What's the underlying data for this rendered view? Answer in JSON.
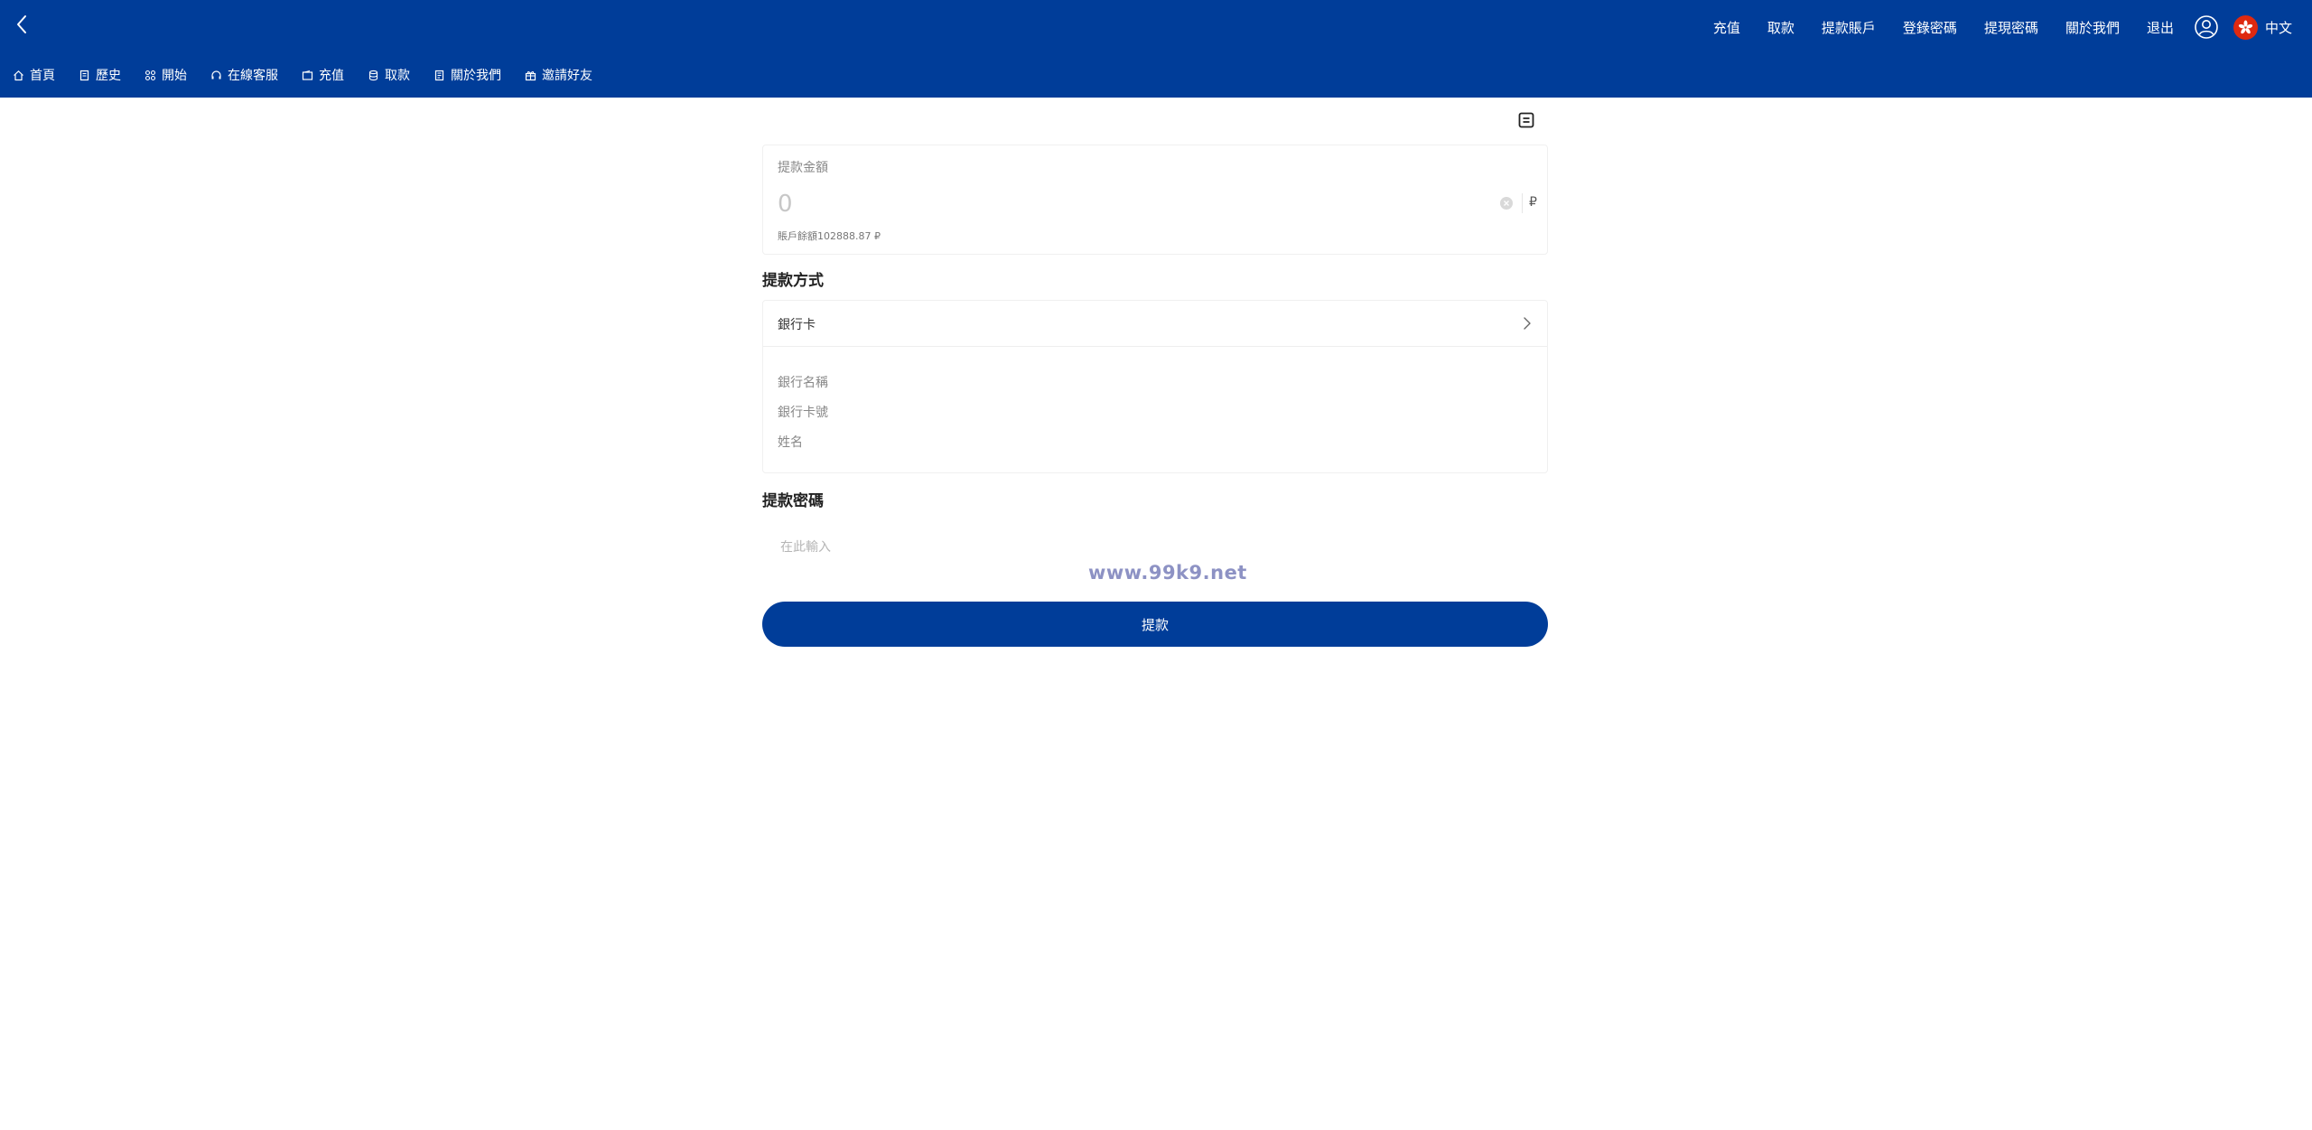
{
  "header": {
    "top_links": [
      "充值",
      "取款",
      "提款賬戶",
      "登錄密碼",
      "提現密碼",
      "關於我們",
      "退出"
    ],
    "language": "中文"
  },
  "nav": {
    "items": [
      {
        "label": "首頁",
        "icon": "home-icon"
      },
      {
        "label": "歷史",
        "icon": "history-icon"
      },
      {
        "label": "開始",
        "icon": "grid-icon"
      },
      {
        "label": "在線客服",
        "icon": "headset-icon"
      },
      {
        "label": "充值",
        "icon": "wallet-icon"
      },
      {
        "label": "取款",
        "icon": "coins-icon"
      },
      {
        "label": "關於我們",
        "icon": "document-icon"
      },
      {
        "label": "邀請好友",
        "icon": "gift-icon"
      }
    ]
  },
  "withdraw": {
    "amount_label": "提款金額",
    "amount_placeholder": "0",
    "currency": "₽",
    "balance_text": "賬戶餘額102888.87 ₽",
    "method_title": "提款方式",
    "method_value": "銀行卡",
    "bank_name_label": "銀行名稱",
    "bank_card_label": "銀行卡號",
    "holder_name_label": "姓名",
    "password_title": "提款密碼",
    "password_placeholder": "在此輸入",
    "submit_label": "提款"
  },
  "watermark": "www.99k9.net",
  "colors": {
    "primary": "#003d99",
    "flag_red": "#de2910"
  }
}
